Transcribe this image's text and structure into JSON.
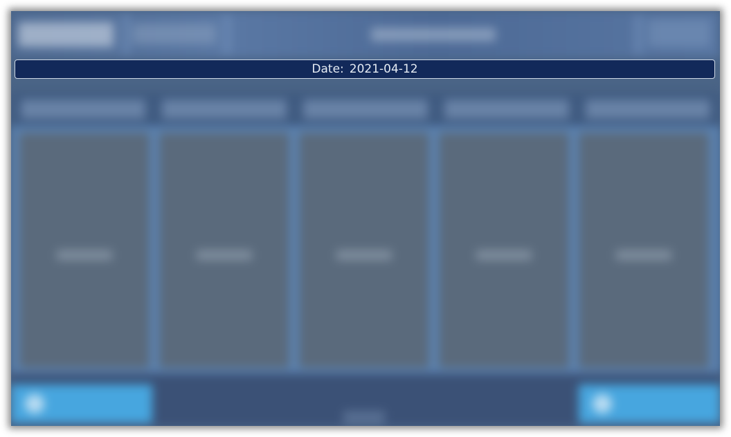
{
  "date_banner": {
    "label": "Date:",
    "value": "2021-04-12"
  },
  "colors": {
    "window_background": "#4a6486",
    "banner_background": "#12295a",
    "banner_border": "#cfd9e6",
    "banner_text": "#e6ecf4",
    "accent_button": "#47a6df"
  }
}
